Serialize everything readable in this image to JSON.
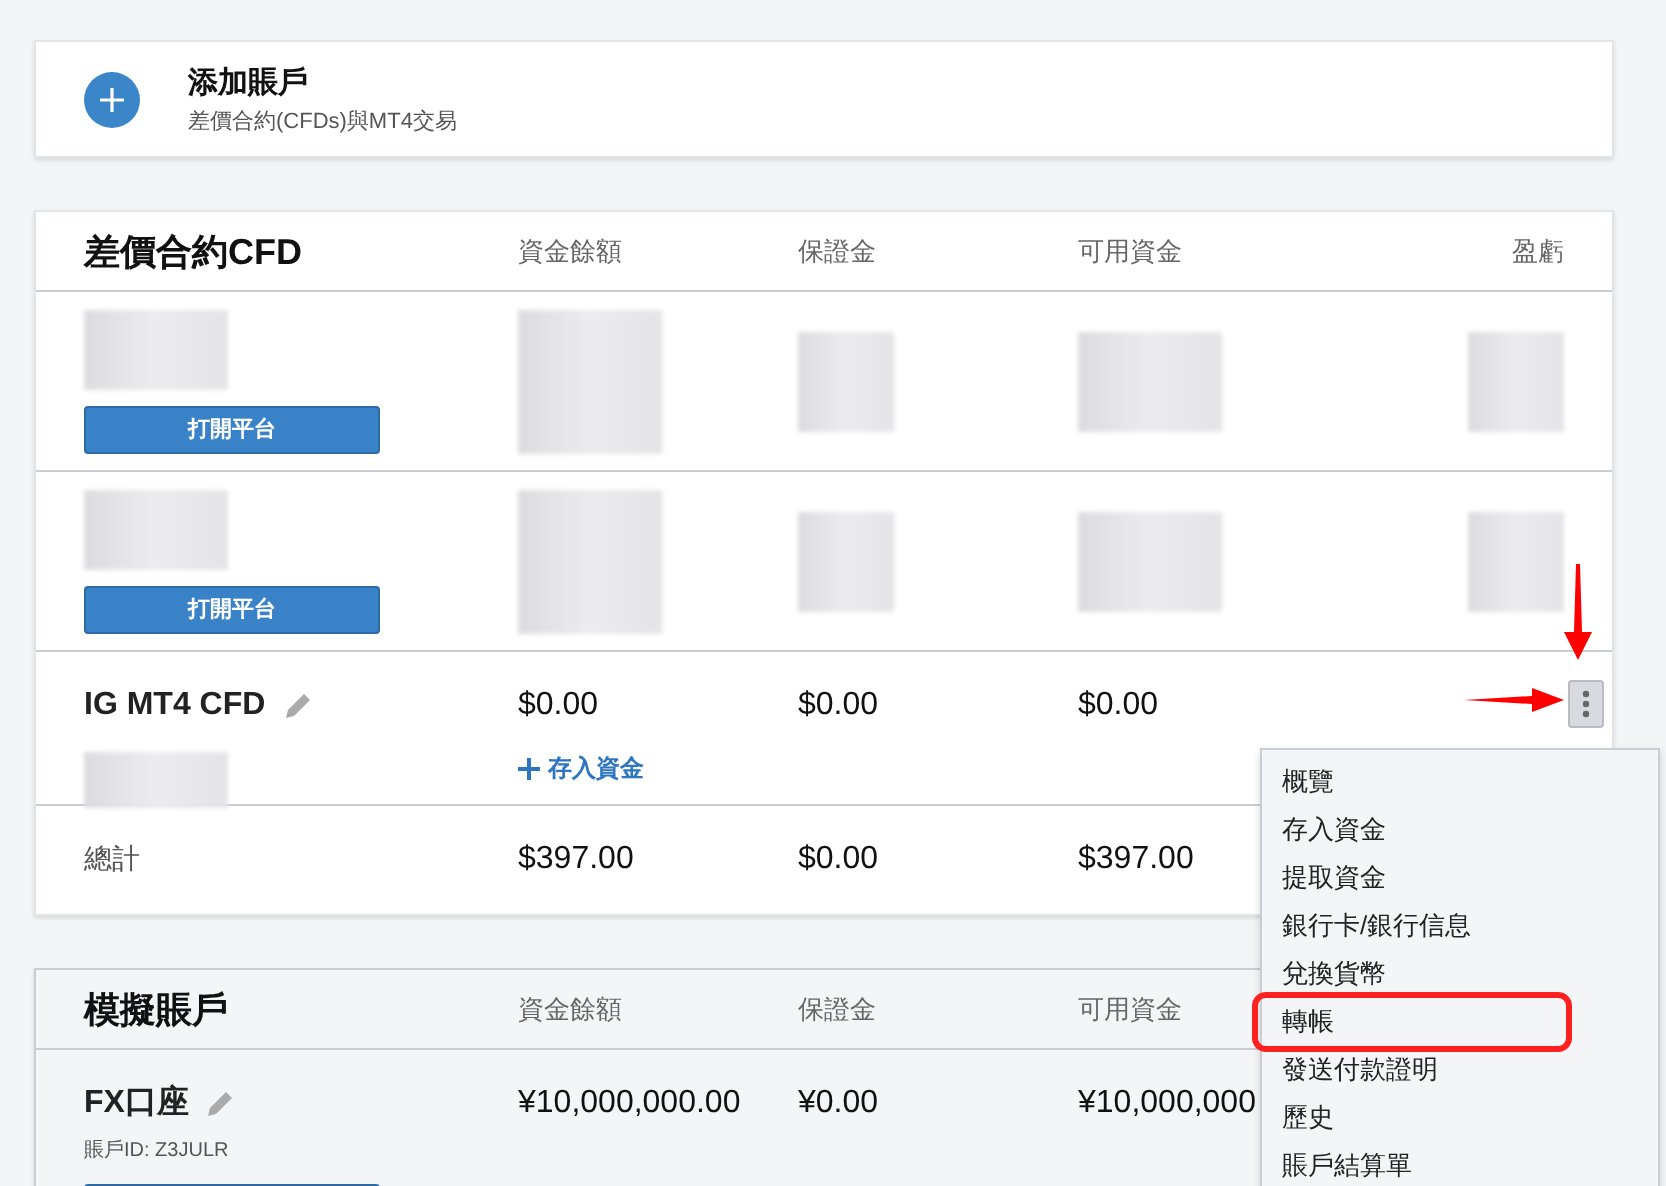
{
  "add_account": {
    "title": "添加賬戶",
    "subtitle": "差價合約(CFDs)與MT4交易"
  },
  "cfd": {
    "title": "差價合約CFD",
    "columns": [
      "資金餘額",
      "保證金",
      "可用資金",
      "盈虧"
    ],
    "rows": [
      {
        "kind": "redacted",
        "button": "打開平台"
      },
      {
        "kind": "redacted",
        "button": "打開平台"
      },
      {
        "kind": "account",
        "name": "IG MT4 CFD",
        "balance": "$0.00",
        "margin": "$0.00",
        "available": "$0.00",
        "action": "存入資金",
        "menu_open": true
      }
    ],
    "total": {
      "label": "總計",
      "balance": "$397.00",
      "margin": "$0.00",
      "available": "$397.00"
    }
  },
  "menu": {
    "items": [
      {
        "label": "概覽",
        "highlighted": false
      },
      {
        "label": "存入資金",
        "highlighted": false
      },
      {
        "label": "提取資金",
        "highlighted": false
      },
      {
        "label": "銀行卡/銀行信息",
        "highlighted": false
      },
      {
        "label": "兌換貨幣",
        "highlighted": false
      },
      {
        "label": "轉帳",
        "highlighted": true
      },
      {
        "label": "發送付款證明",
        "highlighted": false
      },
      {
        "label": "歷史",
        "highlighted": false
      },
      {
        "label": "賬戶結算單",
        "highlighted": false
      }
    ]
  },
  "demo": {
    "title": "模擬賬戶",
    "columns": [
      "資金餘額",
      "保證金",
      "可用資金"
    ],
    "rows": [
      {
        "name": "FX口座",
        "id": "賬戶ID: Z3JULR",
        "balance": "¥10,000,000.00",
        "margin": "¥0.00",
        "available": "¥10,000,000"
      }
    ]
  }
}
